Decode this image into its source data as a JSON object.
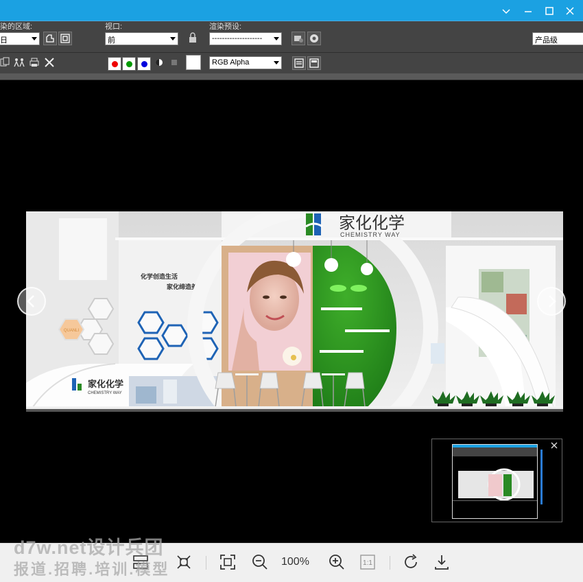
{
  "toolbar": {
    "region_label": "染的区域:",
    "viewport_label": "视口:",
    "viewport_value": "前",
    "preset_label": "渲染预设:",
    "preset_value": "--------------------",
    "product_value": "产品级",
    "channel_value": "RGB Alpha"
  },
  "scene": {
    "brand_cn": "家化化学",
    "brand_en": "CHEMISTRY WAY",
    "slogan1": "化学创造生活",
    "slogan2": "家化缔造美",
    "hex_label": "QUANLI"
  },
  "bottombar": {
    "zoom": "100%",
    "actual_size": "1:1"
  },
  "watermark": {
    "line1": "d7w.net设计兵团",
    "line2": "报道.招聘.培训.模型"
  },
  "colors": {
    "titlebar": "#1ba1e2",
    "toolbar": "#444444",
    "brand_green": "#2a8a24",
    "hex_blue": "#1e63b5"
  }
}
